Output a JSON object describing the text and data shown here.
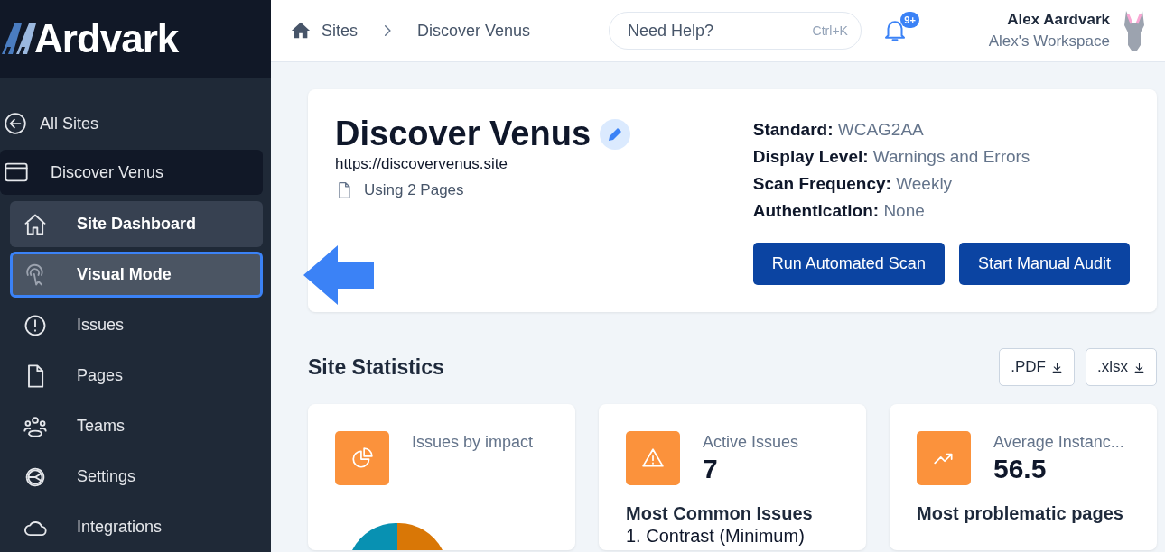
{
  "logo": {
    "text": "Ardvark"
  },
  "sidebar": {
    "back": "All Sites",
    "site": "Discover Venus",
    "items": [
      {
        "label": "Site Dashboard",
        "selected": true,
        "highlighted": false
      },
      {
        "label": "Visual Mode",
        "selected": false,
        "highlighted": true
      },
      {
        "label": "Issues",
        "selected": false,
        "highlighted": false
      },
      {
        "label": "Pages",
        "selected": false,
        "highlighted": false
      },
      {
        "label": "Teams",
        "selected": false,
        "highlighted": false
      },
      {
        "label": "Settings",
        "selected": false,
        "highlighted": false
      },
      {
        "label": "Integrations",
        "selected": false,
        "highlighted": false
      }
    ]
  },
  "header": {
    "breadcrumbs": [
      "Sites",
      "Discover Venus"
    ],
    "search": {
      "placeholder": "Need Help?",
      "shortcut": "Ctrl+K"
    },
    "notifications": "9+",
    "user": {
      "name": "Alex Aardvark",
      "workspace": "Alex's Workspace"
    }
  },
  "site": {
    "title": "Discover Venus",
    "url": "https://discovervenus.site",
    "pages": "Using 2 Pages",
    "details": [
      {
        "label": "Standard:",
        "value": "WCAG2AA"
      },
      {
        "label": "Display Level:",
        "value": "Warnings and Errors"
      },
      {
        "label": "Scan Frequency:",
        "value": "Weekly"
      },
      {
        "label": "Authentication:",
        "value": "None"
      }
    ],
    "buttons": [
      "Run Automated Scan",
      "Start Manual Audit"
    ]
  },
  "statistics": {
    "title": "Site Statistics",
    "exports": [
      ".PDF",
      ".xlsx"
    ],
    "cards": [
      {
        "kind": "chart",
        "label": "Issues by impact"
      },
      {
        "kind": "list",
        "label": "Active Issues",
        "value": "7",
        "heading": "Most Common Issues",
        "items": [
          "1. Contrast (Minimum)"
        ]
      },
      {
        "kind": "list",
        "label": "Average Instanc...",
        "value": "56.5",
        "heading": "Most problematic pages"
      }
    ]
  }
}
